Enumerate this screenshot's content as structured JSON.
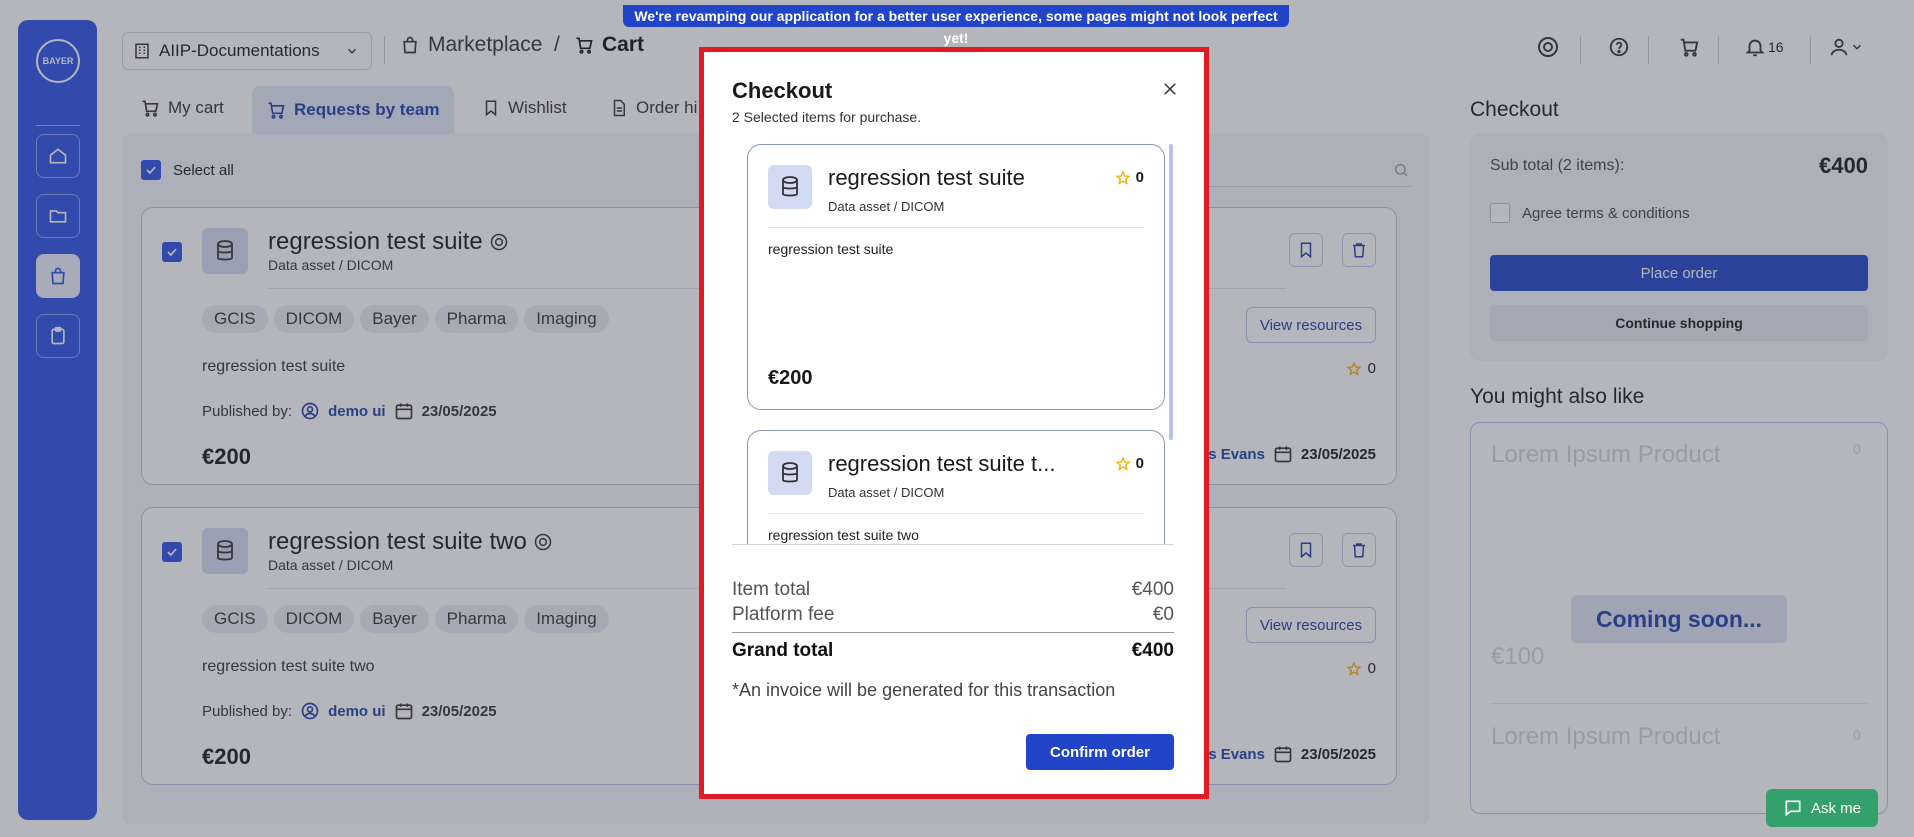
{
  "banner": {
    "text": "We're revamping our application for a better user experience, some pages might not look perfect yet!"
  },
  "sidebar": {
    "logo_text": "BAYER"
  },
  "header": {
    "workspace": "AIIP-Documentations",
    "breadcrumb_marketplace": "Marketplace",
    "breadcrumb_separator": "/",
    "breadcrumb_cart": "Cart",
    "notification_count": "16"
  },
  "tabs": [
    {
      "label": "My cart"
    },
    {
      "label": "Requests by team"
    },
    {
      "label": "Wishlist"
    },
    {
      "label": "Order hi"
    }
  ],
  "list": {
    "select_all": "Select all",
    "items": [
      {
        "title": "regression test suite",
        "subtitle": "Data asset / DICOM",
        "tags": [
          "GCIS",
          "DICOM",
          "Bayer",
          "Pharma",
          "Imaging"
        ],
        "description": "regression test suite",
        "published_by_label": "Published by:",
        "publisher": "demo ui",
        "date": "23/05/2025",
        "price": "€200",
        "view_resources": "View resources",
        "rating": "0",
        "right_publisher": "s Evans",
        "right_date": "23/05/2025"
      },
      {
        "title": "regression test suite two",
        "subtitle": "Data asset / DICOM",
        "tags": [
          "GCIS",
          "DICOM",
          "Bayer",
          "Pharma",
          "Imaging"
        ],
        "description": "regression test suite two",
        "published_by_label": "Published by:",
        "publisher": "demo ui",
        "date": "23/05/2025",
        "price": "€200",
        "view_resources": "View resources",
        "rating": "0",
        "right_publisher": "s Evans",
        "right_date": "23/05/2025"
      }
    ]
  },
  "checkout_panel": {
    "title": "Checkout",
    "subtotal_label": "Sub total (2 items):",
    "subtotal_value": "€400",
    "agree_label": "Agree terms & conditions",
    "place_order": "Place order",
    "continue_shopping": "Continue shopping"
  },
  "also_like": {
    "title": "You might also like",
    "ghost_title": "Lorem Ipsum Product",
    "ghost_rating": "0",
    "ghost_price": "€100",
    "coming_soon": "Coming soon..."
  },
  "ask_me": "Ask me",
  "modal": {
    "title": "Checkout",
    "subtitle": "2 Selected items for purchase.",
    "items": [
      {
        "title": "regression test suite",
        "subtitle": "Data asset / DICOM",
        "rating": "0",
        "description": "regression test suite",
        "price": "€200"
      },
      {
        "title": "regression test suite t...",
        "subtitle": "Data asset / DICOM",
        "rating": "0",
        "description": "regression test suite two"
      }
    ],
    "item_total_label": "Item total",
    "item_total_value": "€400",
    "platform_fee_label": "Platform fee",
    "platform_fee_value": "€0",
    "grand_total_label": "Grand total",
    "grand_total_value": "€400",
    "note": "*An invoice will be generated for this transaction",
    "confirm": "Confirm order"
  },
  "colors": {
    "primary": "#2144c9",
    "sidebar": "#2a52e4",
    "highlight": "#e01b24",
    "star": "#f0b400"
  }
}
